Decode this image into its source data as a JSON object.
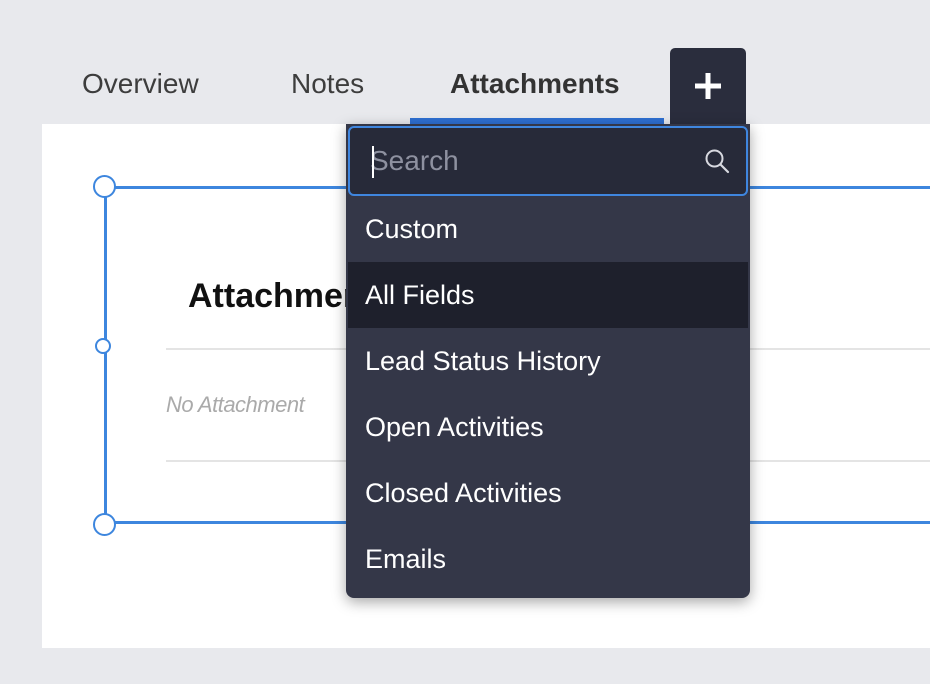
{
  "tabs": {
    "overview": "Overview",
    "notes": "Notes",
    "attachments": "Attachments",
    "add_icon": "plus-icon"
  },
  "section": {
    "title": "Attachments",
    "empty_text": "No Attachment"
  },
  "dropdown": {
    "search_placeholder": "Search",
    "search_value": "",
    "items": [
      {
        "label": "Custom"
      },
      {
        "label": "All Fields"
      },
      {
        "label": "Lead Status History"
      },
      {
        "label": "Open Activities"
      },
      {
        "label": "Closed Activities"
      },
      {
        "label": "Emails"
      }
    ],
    "hovered_item": "All Fields"
  },
  "colors": {
    "accent": "#2e6fd1",
    "dropdown_bg": "#343748",
    "dropdown_hover": "#1e202c",
    "selection_border": "#3d86de"
  }
}
